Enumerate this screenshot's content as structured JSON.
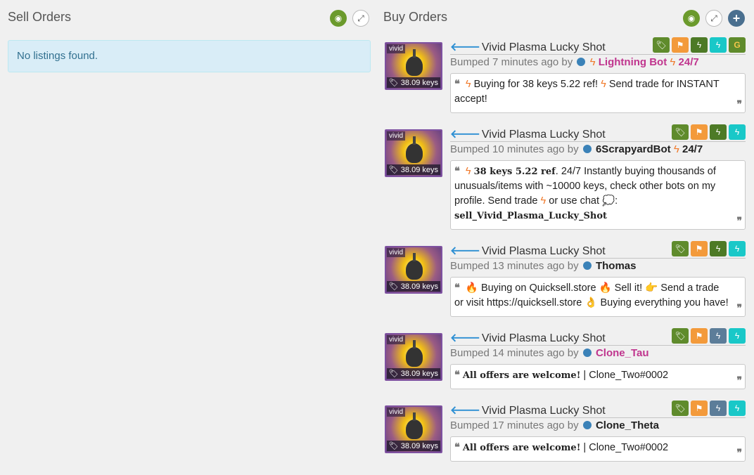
{
  "sell": {
    "title": "Sell Orders",
    "empty_text": "No listings found."
  },
  "buy": {
    "title": "Buy Orders"
  },
  "listings": [
    {
      "item_name": "Vivid Plasma Lucky Shot",
      "quality_tag": "vivid",
      "price_tag": "38.09 keys",
      "bumped": "Bumped 7 minutes ago by",
      "user": "Lightning Bot",
      "user_suffix": "24/7",
      "msg_a": "Buying for 38 keys 5.22 ref!",
      "msg_b": "Send trade for INSTANT accept!"
    },
    {
      "item_name": "Vivid Plasma Lucky Shot",
      "quality_tag": "vivid",
      "price_tag": "38.09 keys",
      "bumped": "Bumped 10 minutes ago by",
      "user": "6ScrapyardBot",
      "user_suffix": "24/7",
      "msg_bold": "38 keys 5.22 ref",
      "msg_a": ". 24/7 Instantly buying thousands of unusuals/items with ~10000 keys, check other bots on my profile. Send  trade",
      "msg_b": "or  use  chat",
      "msg_c": ":",
      "msg_cmd": "sell_Vivid_Plasma_Lucky_Shot"
    },
    {
      "item_name": "Vivid Plasma Lucky Shot",
      "quality_tag": "vivid",
      "price_tag": "38.09 keys",
      "bumped": "Bumped 13 minutes ago by",
      "user": "Thomas",
      "msg_a": "Buying on Quicksell.store",
      "msg_b": "Sell it!",
      "msg_c": "Send a trade or visit https://quicksell.store",
      "msg_d": "Buying everything you have!"
    },
    {
      "item_name": "Vivid Plasma Lucky Shot",
      "quality_tag": "vivid",
      "price_tag": "38.09 keys",
      "bumped": "Bumped 14 minutes ago by",
      "user": "Clone_Tau",
      "msg_bold": "All offers are welcome!",
      "msg_a": " | Clone_Two#0002"
    },
    {
      "item_name": "Vivid Plasma Lucky Shot",
      "quality_tag": "vivid",
      "price_tag": "38.09 keys",
      "bumped": "Bumped 17 minutes ago by",
      "user": "Clone_Theta",
      "msg_bold": "All offers are welcome!",
      "msg_a": " | Clone_Two#0002"
    }
  ],
  "colors": {
    "accent_green": "#6b9a2c",
    "alert_bg": "#d9edf7",
    "item_border": "#7e51a0"
  }
}
